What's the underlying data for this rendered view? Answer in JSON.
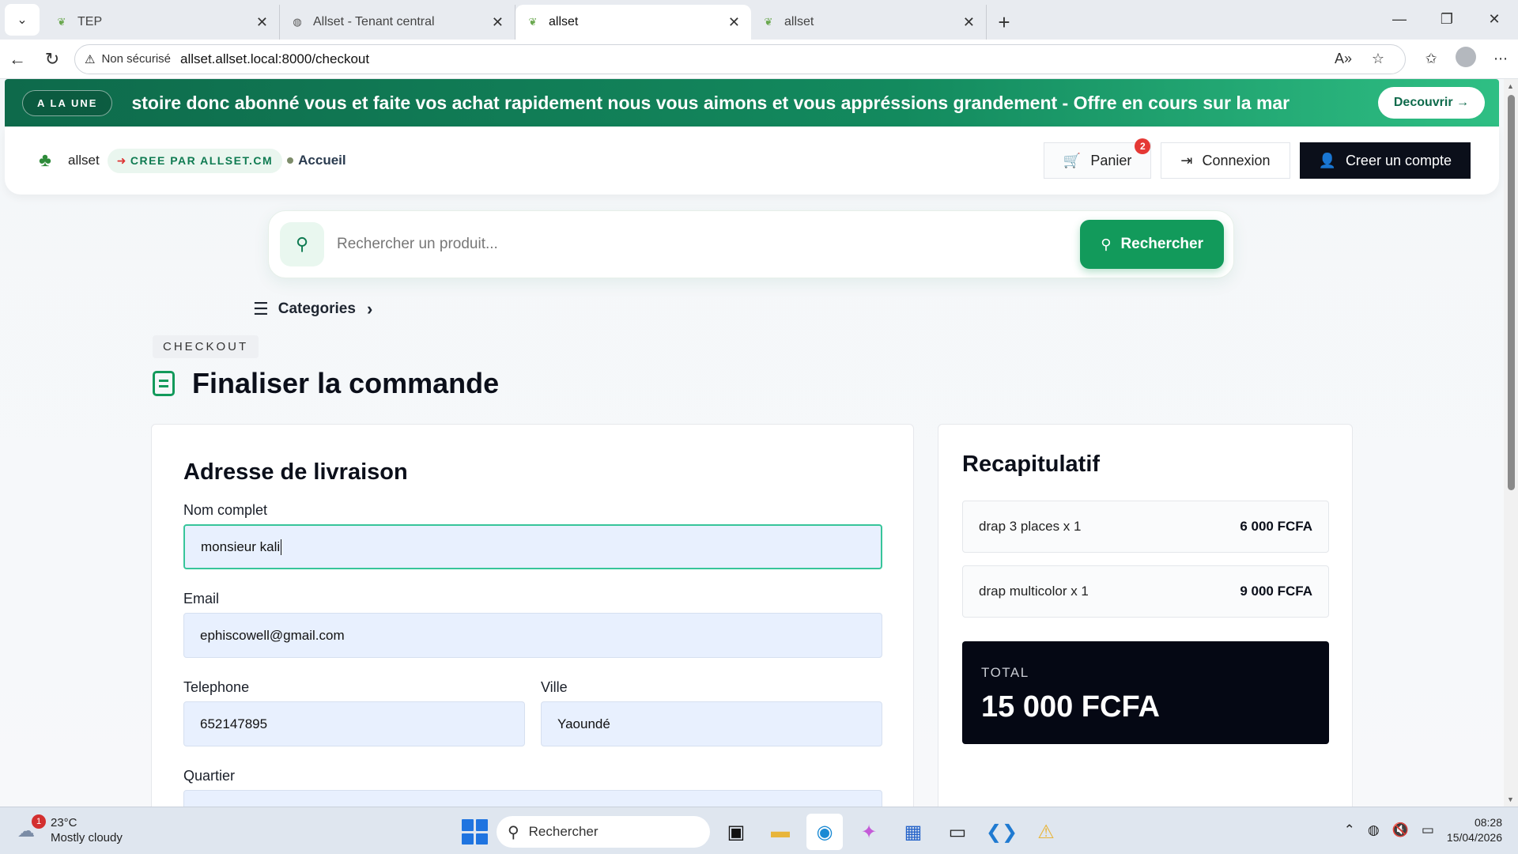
{
  "browser": {
    "tabs": [
      {
        "title": "TEP",
        "favicon": "leaf-icon",
        "active": false
      },
      {
        "title": "Allset - Tenant central",
        "favicon": "globe-icon",
        "active": false
      },
      {
        "title": "allset",
        "favicon": "leaf-icon",
        "active": true
      },
      {
        "title": "allset",
        "favicon": "leaf-icon",
        "active": false
      }
    ],
    "security_label": "Non sécurisé",
    "url": "allset.allset.local:8000/checkout"
  },
  "banner": {
    "badge": "A LA UNE",
    "ticker": "stoire donc abonné vous et faite vos achat rapidement nous vous aimons et vous appréssions grandement - Offre en cours sur la mar",
    "cta": "Decouvrir →"
  },
  "header": {
    "brand": "allset",
    "cree_par": "CREE PAR ALLSET.CM",
    "accueil": "Accueil",
    "panier": "Panier",
    "panier_count": "2",
    "connexion": "Connexion",
    "creer_compte": "Creer un compte"
  },
  "search": {
    "placeholder": "Rechercher un produit...",
    "button": "Rechercher"
  },
  "categories": {
    "label": "Categories"
  },
  "checkout": {
    "tag": "CHECKOUT",
    "title": "Finaliser la commande"
  },
  "form": {
    "heading": "Adresse de livraison",
    "nom_label": "Nom complet",
    "nom_value": "monsieur kali",
    "email_label": "Email",
    "email_value": "ephiscowell@gmail.com",
    "telephone_label": "Telephone",
    "telephone_value": "652147895",
    "ville_label": "Ville",
    "ville_value": "Yaoundé",
    "quartier_label": "Quartier"
  },
  "recap": {
    "title": "Recapitulatif",
    "items": [
      {
        "name": "drap 3 places x 1",
        "price": "6 000 FCFA"
      },
      {
        "name": "drap multicolor x 1",
        "price": "9 000 FCFA"
      }
    ],
    "total_label": "TOTAL",
    "total_value": "15 000 FCFA"
  },
  "taskbar": {
    "weather_alert": "1",
    "temperature": "23°C",
    "condition": "Mostly cloudy",
    "search_label": "Rechercher",
    "time": "08:28",
    "date": "15/04/2026"
  },
  "colors": {
    "brand_green": "#129a5b",
    "banner_dark": "#0e6a4b",
    "dark": "#0b0f1a",
    "alert_red": "#e53935"
  }
}
